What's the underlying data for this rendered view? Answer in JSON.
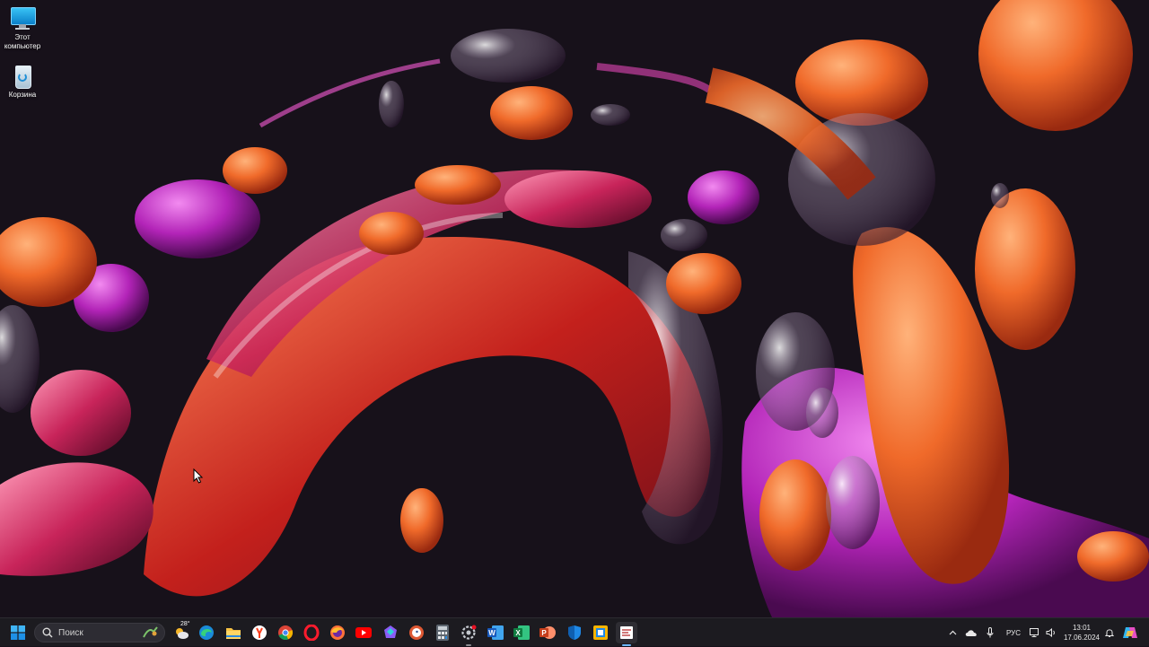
{
  "desktop": {
    "icons": [
      {
        "label_line1": "Этот",
        "label_line2": "компьютер",
        "icon": "this-pc-icon"
      },
      {
        "label_line1": "Корзина",
        "label_line2": "",
        "icon": "recycle-bin-icon"
      }
    ]
  },
  "taskbar": {
    "search_placeholder": "Поиск",
    "weather_temp": "28°",
    "apps": [
      "start-icon",
      "widgets-icon",
      "weather-icon",
      "edge-icon",
      "file-explorer-icon",
      "yandex-browser-icon",
      "chrome-icon",
      "opera-icon",
      "firefox-icon",
      "youtube-icon",
      "copilot-icon",
      "duckduckgo-icon",
      "calculator-icon",
      "settings-icon",
      "word-icon",
      "excel-icon",
      "powerpoint-icon",
      "defender-icon",
      "snipping-tool-icon",
      "paint-icon"
    ],
    "tray": {
      "language": "РУС",
      "time": "13:01",
      "date": "17.06.2024"
    }
  },
  "colors": {
    "taskbar_bg": "#1c1b20",
    "wallpaper_bg": "#17111a",
    "accent": "#0078d4"
  }
}
